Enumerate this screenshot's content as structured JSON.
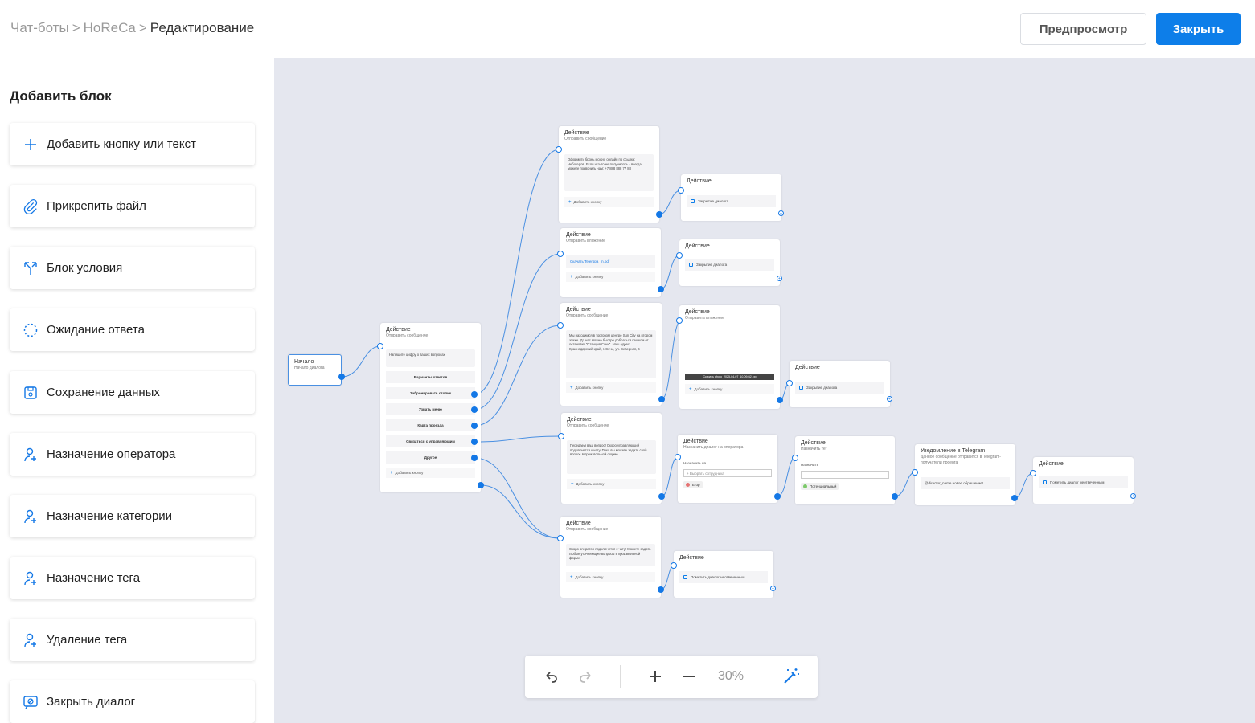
{
  "breadcrumb": {
    "items": [
      "Чат-боты",
      "HoReCa"
    ],
    "current": "Редактирование",
    "separator": ">"
  },
  "header": {
    "preview_label": "Предпросмотр",
    "close_label": "Закрыть"
  },
  "colors": {
    "accent": "#0d7ee9",
    "canvas": "#e5e7ef"
  },
  "sidebar": {
    "title": "Добавить блок",
    "items": [
      {
        "label": "Добавить кнопку или текст",
        "icon": "plus-icon"
      },
      {
        "label": "Прикрепить файл",
        "icon": "paperclip-icon"
      },
      {
        "label": "Блок условия",
        "icon": "branch-icon"
      },
      {
        "label": "Ожидание ответа",
        "icon": "dashed-circle-icon"
      },
      {
        "label": "Сохранение данных",
        "icon": "save-icon"
      },
      {
        "label": "Назначение оператора",
        "icon": "user-plus-icon"
      },
      {
        "label": "Назначение категории",
        "icon": "user-plus-icon"
      },
      {
        "label": "Назначение тега",
        "icon": "user-plus-icon"
      },
      {
        "label": "Удаление тега",
        "icon": "user-plus-icon"
      },
      {
        "label": "Закрыть диалог",
        "icon": "close-dialog-icon"
      }
    ]
  },
  "flow": {
    "start": {
      "title": "Начало",
      "subtitle": "Начало диалога"
    },
    "main": {
      "title": "Действие",
      "subtitle": "Отправить сообщение",
      "message": "Напишите цифру о ваших вопросах",
      "options": [
        "Варианты ответов",
        "Забронировать столик",
        "Узнать меню",
        "Карта проезда",
        "Связаться с управляющим",
        "Другое"
      ],
      "add_button": "Добавить кнопку"
    },
    "n1": {
      "title": "Действие",
      "subtitle": "Отправить сообщение",
      "message": "Оформить бронь можно онлайн по ссылке: Небоrepos. Если что-то не получилось - всегда можете позвонить нам: +7 888 888 77 88",
      "add_button": "Добавить кнопку"
    },
    "n1c": {
      "title": "Действие",
      "row": "Закрытие диалога"
    },
    "n2": {
      "title": "Действие",
      "subtitle": "Отправить вложение",
      "file": "Скачать Telergpa_m.pdf",
      "add_button": "Добавить кнопку"
    },
    "n2c": {
      "title": "Действие",
      "row": "Закрытие диалога"
    },
    "n3": {
      "title": "Действие",
      "subtitle": "Отправить сообщение",
      "message": "Мы находимся в торговом центре Sun City на втором этаже. До нас можно быстро добраться пешком от остановки \"Станция Сочи\". Наш адрес: Краснодарский край, г. Сочи, ул. Северная, 6",
      "add_button": "Добавить кнопку"
    },
    "n3b": {
      "title": "Действие",
      "subtitle": "Отправить вложение",
      "file": "Скачать photo_2025-04-07_10-09-42.jpg",
      "add_button": "Добавить кнопку"
    },
    "n3c": {
      "title": "Действие",
      "row": "Закрытие диалога"
    },
    "n4": {
      "title": "Действие",
      "subtitle": "Отправить сообщение",
      "message": "Передаем ваш вопрос! Скоро управляющий подключится к чату. Пока вы можете задать свой вопрос в произвольной форме.",
      "add_button": "Добавить кнопку"
    },
    "n4b": {
      "title": "Действие",
      "subtitle": "Назначить диалог на оператора",
      "label": "Назначить на",
      "placeholder": "+ Выбрать сотрудника",
      "chip": "Егор"
    },
    "n4c": {
      "title": "Действие",
      "subtitle": "Назначить тег",
      "label": "Назначить",
      "chip": "Потенциальный"
    },
    "n4d": {
      "title": "Уведомление в Telegram",
      "subtitle": "Данное сообщение отправится в Telegram-получатели проекта",
      "row": "@director_name новое обращение!"
    },
    "n4e": {
      "title": "Действие",
      "row": "Пометить диалог неотвеченным"
    },
    "n5": {
      "title": "Действие",
      "subtitle": "Отправить сообщение",
      "message": "Скоро оператор подключится к чату! Можете задать любые уточняющие вопросы в произвольной форме.",
      "add_button": "Добавить кнопку"
    },
    "n5c": {
      "title": "Действие",
      "row": "Пометить диалог неотвеченным"
    }
  },
  "toolbar": {
    "zoom": "30%",
    "undo_icon": "undo-icon",
    "redo_icon": "redo-icon",
    "zoom_in_icon": "zoom-in-icon",
    "zoom_out_icon": "zoom-out-icon",
    "magic_icon": "magic-wand-icon"
  }
}
